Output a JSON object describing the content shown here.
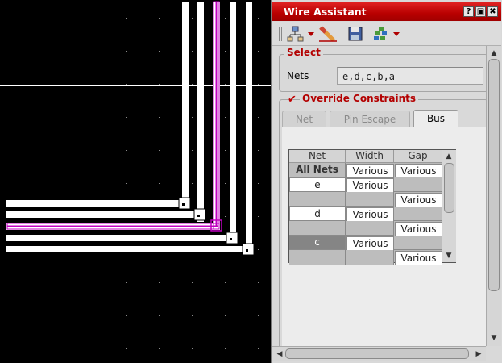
{
  "panel": {
    "title": "Wire Assistant",
    "title_buttons": [
      "?",
      "▣",
      "✖"
    ],
    "toolbar_icons": [
      "hierarchy-icon",
      "eraser-icon",
      "save-icon",
      "tree-icon"
    ]
  },
  "select_section": {
    "title": "Select",
    "nets_label": "Nets",
    "nets_value": "e,d,c,b,a"
  },
  "override_section": {
    "title": "Override Constraints",
    "checked": true,
    "tabs": [
      {
        "label": "Net",
        "active": false
      },
      {
        "label": "Pin Escape",
        "active": false
      },
      {
        "label": "Bus",
        "active": true
      }
    ]
  },
  "bus_table": {
    "headers": [
      "Net",
      "Width",
      "Gap"
    ],
    "rows": [
      {
        "net": "All Nets",
        "width": "Various",
        "gap": "Various"
      },
      {
        "net": "e",
        "width": "Various",
        "gap": ""
      },
      {
        "net": "",
        "width": "",
        "gap": "Various"
      },
      {
        "net": "d",
        "width": "Various",
        "gap": ""
      },
      {
        "net": "",
        "width": "",
        "gap": "Various"
      },
      {
        "net": "c",
        "width": "Various",
        "gap": ""
      },
      {
        "net": "",
        "width": "",
        "gap": "Various"
      }
    ]
  },
  "colors": {
    "title_bar": "#c00000",
    "section_title": "#b30000",
    "selected_wire": "#c000c0",
    "wire": "#ffffff",
    "canvas": "#000000"
  }
}
